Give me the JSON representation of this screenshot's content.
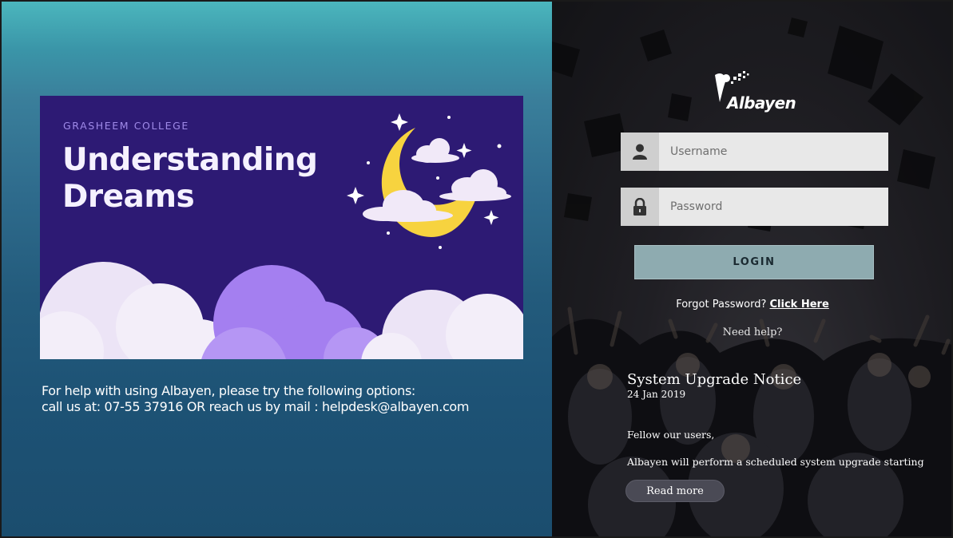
{
  "banner": {
    "college": "GRASHEEM COLLEGE",
    "title_line1": "Understanding",
    "title_line2": "Dreams"
  },
  "help": {
    "line1": "For help with using Albayen, please try the following options:",
    "line2": "call us at: 07-55 37916 OR reach us by mail : helpdesk@albayen.com"
  },
  "brand": {
    "name": "Albayen"
  },
  "login_form": {
    "username": {
      "value": "",
      "placeholder": "Username",
      "icon": "user-icon"
    },
    "password": {
      "value": "",
      "placeholder": "Password",
      "icon": "lock-icon"
    },
    "login_label": "LOGIN",
    "forgot_prefix": "Forgot Password?",
    "forgot_link": "Click Here",
    "need_help": "Need help?"
  },
  "notice": {
    "title": "System Upgrade Notice",
    "date": "24 Jan 2019",
    "greeting": "Fellow our users,",
    "body": "Albayen will perform a scheduled system upgrade starting",
    "read_more": "Read more"
  },
  "colors": {
    "left_top": "#4bb6bd",
    "left_bottom": "#1b4d6e",
    "banner_bg": "#2d1a74",
    "login_button": "#8eabb0"
  }
}
